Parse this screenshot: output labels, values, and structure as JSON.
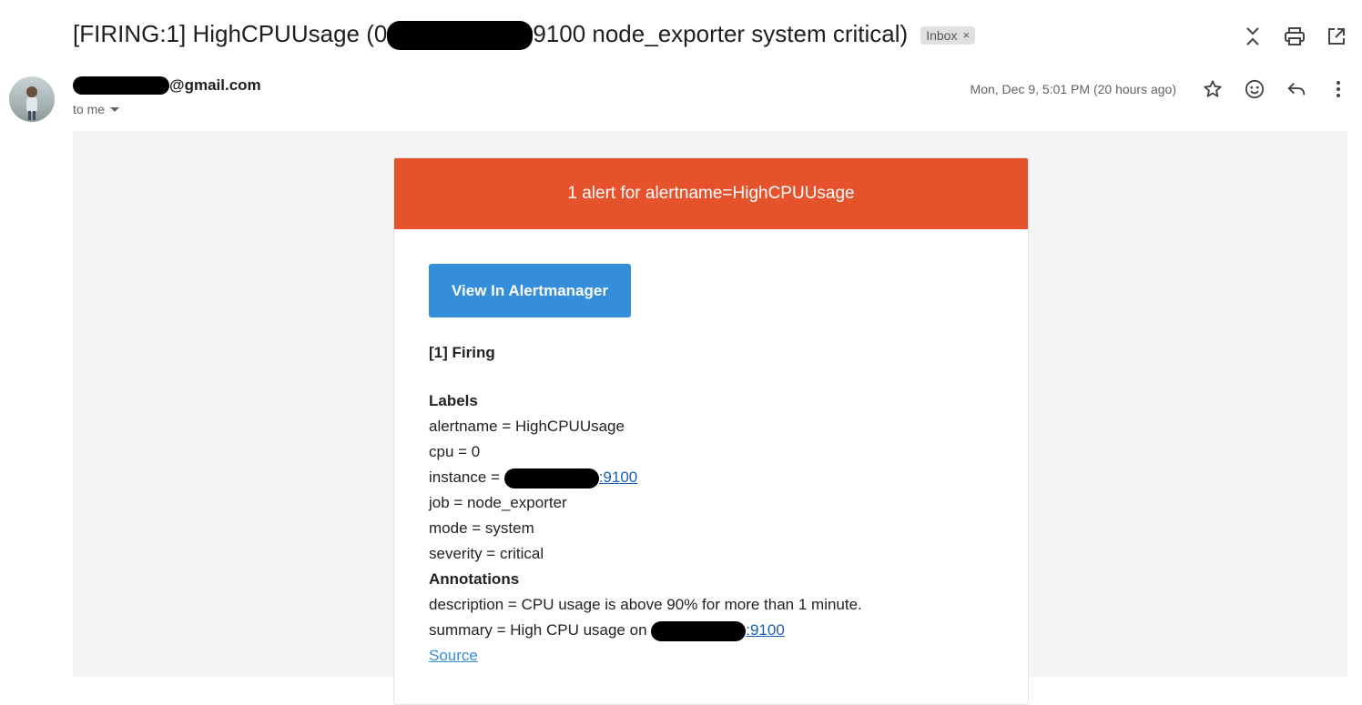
{
  "header": {
    "subject_prefix": "[FIRING:1] HighCPUUsage (0",
    "subject_suffix": "9100 node_exporter system critical)",
    "inbox_label": "Inbox",
    "inbox_close": "×"
  },
  "sender": {
    "email_suffix": "@gmail.com",
    "to_label": "to me",
    "date": "Mon, Dec 9, 5:01 PM (20 hours ago)"
  },
  "alert": {
    "header": "1 alert for alertname=HighCPUUsage",
    "button_label": "View In Alertmanager",
    "firing": "[1] Firing",
    "labels_title": "Labels",
    "labels": {
      "alertname": "alertname = HighCPUUsage",
      "cpu": "cpu = 0",
      "instance_prefix": "instance = ",
      "instance_port": ":9100",
      "job": "job = node_exporter",
      "mode": "mode = system",
      "severity": "severity = critical"
    },
    "annotations_title": "Annotations",
    "annotations": {
      "description": "description = CPU usage is above 90% for more than 1 minute.",
      "summary_prefix": "summary = High CPU usage on ",
      "summary_port": ":9100"
    },
    "source_label": "Source"
  },
  "colors": {
    "alert_header": "#e6522c",
    "button": "#348eda"
  }
}
